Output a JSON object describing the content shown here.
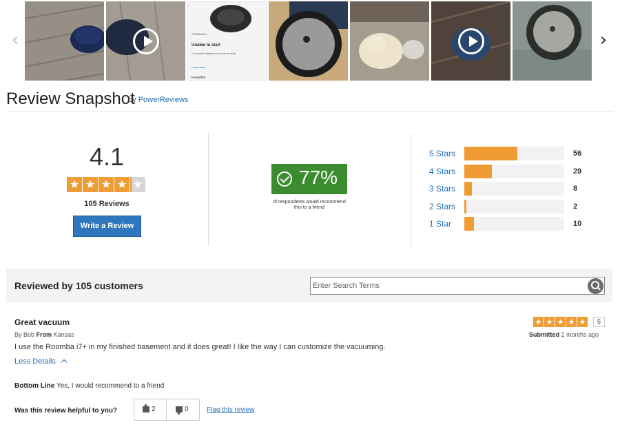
{
  "carousel": {
    "thumbnails": [
      {
        "id": "photo-1",
        "kind": "image"
      },
      {
        "id": "video-1",
        "kind": "video"
      },
      {
        "id": "app-screenshot",
        "kind": "image",
        "label": "CONSUELA",
        "status": "Unable to start",
        "message": "Consuela's battery is too low to start.",
        "link": "Learn more",
        "footer": "Favorites"
      },
      {
        "id": "photo-3",
        "kind": "image"
      },
      {
        "id": "photo-4",
        "kind": "image"
      },
      {
        "id": "video-2",
        "kind": "video"
      },
      {
        "id": "photo-6",
        "kind": "image"
      }
    ]
  },
  "snapshot": {
    "title": "Review Snapshot",
    "by_prefix": "by",
    "by_link": "PowerReviews",
    "average": "4.1",
    "average_value": 4.1,
    "reviews_count": "105 Reviews",
    "write_review": "Write a Review",
    "recommend_pct": "77%",
    "recommend_text": "of respondents would recommend this to a friend",
    "distribution": [
      {
        "label": "5 Stars",
        "count": 56
      },
      {
        "label": "4 Stars",
        "count": 29
      },
      {
        "label": "3 Stars",
        "count": 8
      },
      {
        "label": "2 Stars",
        "count": 2
      },
      {
        "label": "1 Star",
        "count": 10
      }
    ]
  },
  "reviews_bar": {
    "title": "Reviewed by 105 customers",
    "search_placeholder": "Enter Search Terms"
  },
  "review": {
    "headline": "Great vacuum",
    "by_label": "By",
    "author": "Bob",
    "from_label": "From",
    "location": "Kansas",
    "body": "I use the Roomba i7+ in my finished basement and it does great! I like the way I can customize the vacuuming.",
    "less_details": "Less Details",
    "rating": "5",
    "rating_value": 5,
    "submitted_label": "Submitted",
    "submitted_when": "2 months ago",
    "bottom_line_label": "Bottom Line",
    "bottom_line_value": "Yes, I would recommend to a friend",
    "helpful_question": "Was this review helpful to you?",
    "helpful_yes": "2",
    "helpful_no": "0",
    "flag": "Flag this review"
  },
  "colors": {
    "accent_orange": "#ef9c34",
    "link_blue": "#1f6fb6",
    "button_blue": "#2f77bd",
    "recommend_green": "#3b8c2f"
  }
}
